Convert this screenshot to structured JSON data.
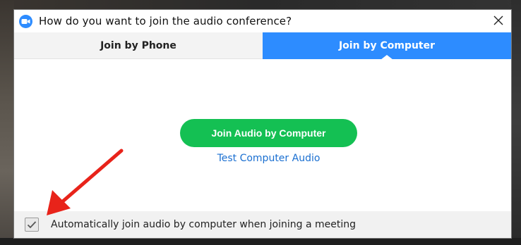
{
  "dialog": {
    "title": "How do you want to join the audio conference?",
    "app_icon": "zoom-camera-icon",
    "close_icon": "close-icon"
  },
  "tabs": [
    {
      "label": "Join by Phone",
      "selected": false
    },
    {
      "label": "Join by Computer",
      "selected": true
    }
  ],
  "content": {
    "join_button_label": "Join Audio by Computer",
    "test_link_label": "Test Computer Audio"
  },
  "footer": {
    "checkbox_checked": true,
    "checkbox_label": "Automatically join audio by computer when joining a meeting"
  },
  "annotation": {
    "arrow_icon": "red-arrow-icon",
    "arrow_color": "#e8231a"
  },
  "colors": {
    "accent_blue": "#2d8cff",
    "join_green": "#14c053",
    "link_blue": "#1a6fd1"
  }
}
